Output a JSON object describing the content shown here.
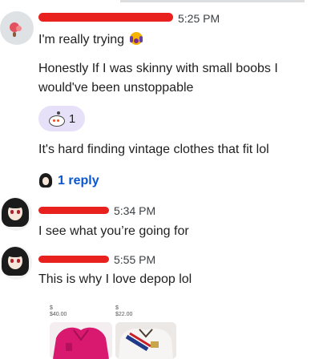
{
  "comments": [
    {
      "time": "5:25 PM",
      "messages": [
        "I'm really trying",
        "Honestly If I was skinny with small boobs I",
        "would've been unstoppable"
      ],
      "reaction": {
        "icon": "snoo-icon",
        "count": "1"
      },
      "extra_message": "It's hard finding vintage clothes that fit lol",
      "replies_label": "1 reply"
    },
    {
      "time": "5:34 PM",
      "message": "I see what you’re going for"
    },
    {
      "time": "5:55 PM",
      "message": "This is why I love depop lol",
      "listings": [
        {
          "currency": "$",
          "price": "$40.00"
        },
        {
          "currency": "$",
          "price": "$22.00"
        }
      ]
    }
  ],
  "colors": {
    "redaction": "#e8201e",
    "reaction_bg": "#e6e1f9",
    "link_blue": "#0b57d0"
  }
}
